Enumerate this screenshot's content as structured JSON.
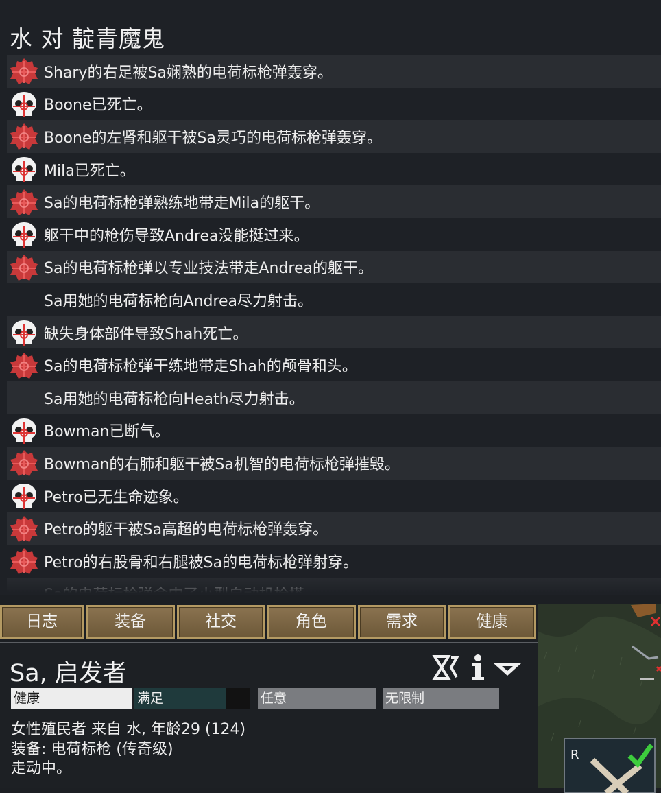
{
  "log": {
    "title": "水 对 靛青魔鬼",
    "entries": [
      {
        "icon": "wound-icon",
        "text": "Shary的右足被Sa娴熟的电荷标枪弹轰穿。"
      },
      {
        "icon": "skull-icon",
        "text": "Boone已死亡。"
      },
      {
        "icon": "wound-icon",
        "text": "Boone的左肾和躯干被Sa灵巧的电荷标枪弹轰穿。"
      },
      {
        "icon": "skull-icon",
        "text": "Mila已死亡。"
      },
      {
        "icon": "wound-icon",
        "text": "Sa的电荷标枪弹熟练地带走Mila的躯干。"
      },
      {
        "icon": "skull-icon",
        "text": "躯干中的枪伤导致Andrea没能挺过来。"
      },
      {
        "icon": "wound-icon",
        "text": "Sa的电荷标枪弹以专业技法带走Andrea的躯干。"
      },
      {
        "icon": "none",
        "text": "Sa用她的电荷标枪向Andrea尽力射击。"
      },
      {
        "icon": "skull-icon",
        "text": "缺失身体部件导致Shah死亡。"
      },
      {
        "icon": "wound-icon",
        "text": "Sa的电荷标枪弹干练地带走Shah的颅骨和头。"
      },
      {
        "icon": "none",
        "text": "Sa用她的电荷标枪向Heath尽力射击。"
      },
      {
        "icon": "skull-icon",
        "text": "Bowman已断气。"
      },
      {
        "icon": "wound-icon",
        "text": "Bowman的右肺和躯干被Sa机智的电荷标枪弹摧毁。"
      },
      {
        "icon": "skull-icon",
        "text": "Petro已无生命迹象。"
      },
      {
        "icon": "wound-icon",
        "text": "Petro的躯干被Sa高超的电荷标枪弹轰穿。"
      },
      {
        "icon": "wound-icon",
        "text": "Petro的右股骨和右腿被Sa的电荷标枪弹射穿。"
      },
      {
        "icon": "none",
        "text": "Sa的电荷标枪弹命中了小型自动机枪塔"
      }
    ]
  },
  "tabs": [
    "日志",
    "装备",
    "社交",
    "角色",
    "需求",
    "健康"
  ],
  "pawn": {
    "name": "Sa, 启发者",
    "bars": {
      "health": "健康",
      "mood": "满足",
      "mood_level": 0.8,
      "area": "任意",
      "restriction": "无限制"
    },
    "description": "女性殖民者 来自 水, 年龄29 (124)",
    "equipment": "装备: 电荷标枪 (传奇级)",
    "status": "走动中。"
  },
  "map": {
    "gizmo_label": "R"
  },
  "colors": {
    "wound": "#c8393a",
    "tab_bg": "#7d6744",
    "tab_border": "#b49a63",
    "mood_fill": "#1f3a3c",
    "bar_gray": "#7a7c80"
  }
}
